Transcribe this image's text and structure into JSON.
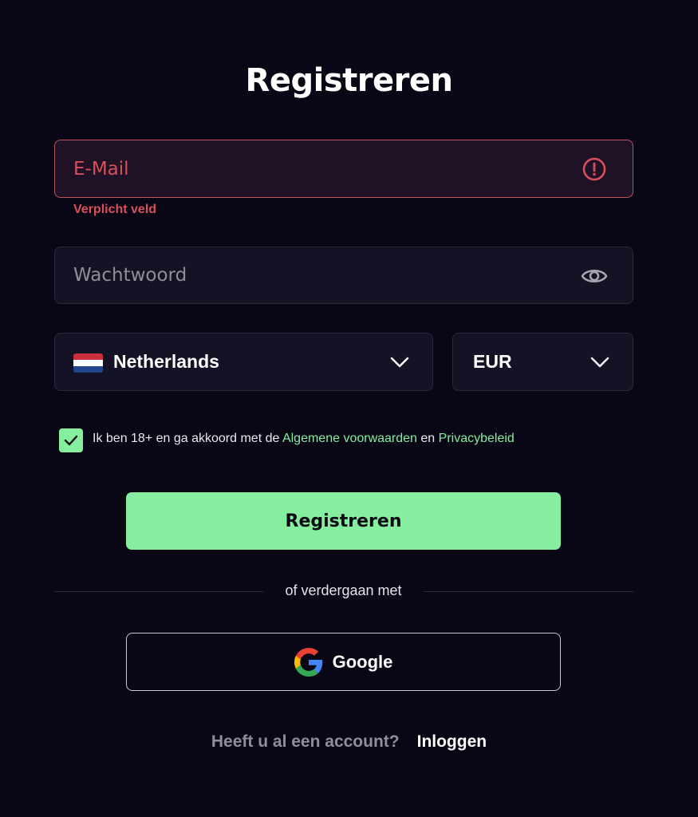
{
  "title": "Registreren",
  "email": {
    "placeholder": "E-Mail",
    "value": "",
    "error": "Verplicht veld",
    "icon": "error-icon"
  },
  "password": {
    "placeholder": "Wachtwoord",
    "value": "",
    "icon": "eye-icon"
  },
  "country": {
    "selected": "Netherlands",
    "icon": "netherlands-flag-icon"
  },
  "currency": {
    "selected": "EUR"
  },
  "consent": {
    "checked": true,
    "text_before": "Ik ben 18+ en ga akkoord met de ",
    "terms_link": "Algemene voorwaarden",
    "text_between": " en ",
    "privacy_link": "Privacybeleid"
  },
  "register_button": "Registreren",
  "divider_text": "of verdergaan met",
  "google_button": "Google",
  "footer": {
    "question": "Heeft u al een account?",
    "login_link": "Inloggen"
  },
  "colors": {
    "background": "#090616",
    "accent": "#86ee9f",
    "error": "#d9505b",
    "field": "#141325"
  }
}
